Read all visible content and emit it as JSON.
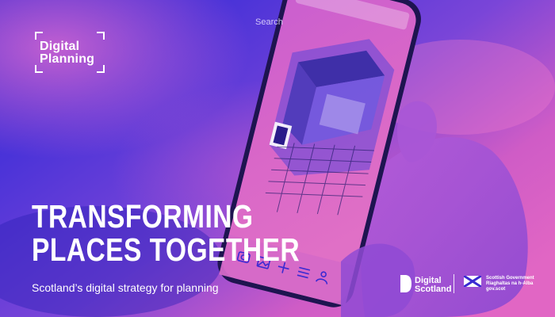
{
  "brand": {
    "line1": "Digital",
    "line2": "Planning"
  },
  "headline": {
    "line1": "TRANSFORMING",
    "line2": "PLACES TOGETHER"
  },
  "subtitle": "Scotland’s digital strategy for planning",
  "phone": {
    "search_placeholder": "Search",
    "toolbar_icons": [
      "camera-icon",
      "image-icon",
      "plus-icon",
      "menu-icon",
      "user-icon"
    ]
  },
  "partners": {
    "digital_scotland": {
      "line1": "Digital",
      "line2": "Scotland"
    },
    "scottish_government": {
      "line1": "Scottish Government",
      "line2": "Riaghaltas na h-Alba",
      "line3": "gov.scot"
    }
  },
  "colors": {
    "pink": "#e05fc6",
    "blue": "#3b2bd6",
    "deep": "#2a1a8a"
  }
}
